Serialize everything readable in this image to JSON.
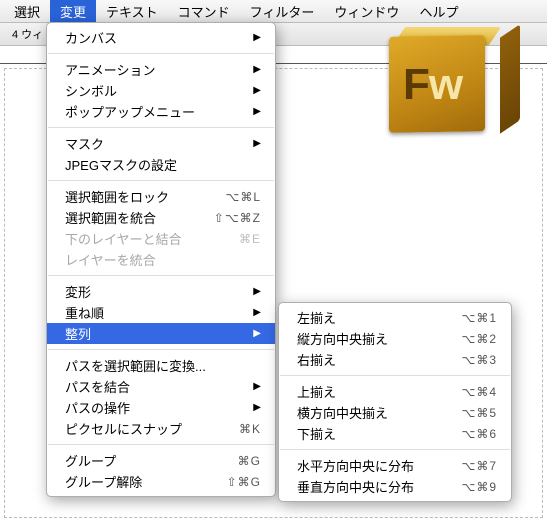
{
  "menubar": {
    "items": [
      "選択",
      "変更",
      "テキスト",
      "コマンド",
      "フィルター",
      "ウィンドウ",
      "ヘルプ"
    ],
    "active_index": 1
  },
  "toolbar": {
    "tab_label": "4 ウィ"
  },
  "logo": {
    "text_f": "F",
    "text_w": "w"
  },
  "menu_main": [
    {
      "type": "item",
      "label": "カンバス",
      "submenu": true
    },
    {
      "type": "sep"
    },
    {
      "type": "item",
      "label": "アニメーション",
      "submenu": true
    },
    {
      "type": "item",
      "label": "シンボル",
      "submenu": true
    },
    {
      "type": "item",
      "label": "ポップアップメニュー",
      "submenu": true
    },
    {
      "type": "sep"
    },
    {
      "type": "item",
      "label": "マスク",
      "submenu": true
    },
    {
      "type": "item",
      "label": "JPEGマスクの設定"
    },
    {
      "type": "sep"
    },
    {
      "type": "item",
      "label": "選択範囲をロック",
      "shortcut": "⌥⌘L"
    },
    {
      "type": "item",
      "label": "選択範囲を統合",
      "shortcut": "⇧⌥⌘Z"
    },
    {
      "type": "item",
      "label": "下のレイヤーと結合",
      "shortcut": "⌘E",
      "disabled": true
    },
    {
      "type": "item",
      "label": "レイヤーを統合",
      "disabled": true
    },
    {
      "type": "sep"
    },
    {
      "type": "item",
      "label": "変形",
      "submenu": true
    },
    {
      "type": "item",
      "label": "重ね順",
      "submenu": true
    },
    {
      "type": "item",
      "label": "整列",
      "submenu": true,
      "highlight": true
    },
    {
      "type": "sep"
    },
    {
      "type": "item",
      "label": "パスを選択範囲に変換..."
    },
    {
      "type": "item",
      "label": "パスを結合",
      "submenu": true
    },
    {
      "type": "item",
      "label": "パスの操作",
      "submenu": true
    },
    {
      "type": "item",
      "label": "ピクセルにスナップ",
      "shortcut": "⌘K"
    },
    {
      "type": "sep"
    },
    {
      "type": "item",
      "label": "グループ",
      "shortcut": "⌘G"
    },
    {
      "type": "item",
      "label": "グループ解除",
      "shortcut": "⇧⌘G"
    }
  ],
  "menu_sub": [
    {
      "type": "item",
      "label": "左揃え",
      "shortcut": "⌥⌘1"
    },
    {
      "type": "item",
      "label": "縦方向中央揃え",
      "shortcut": "⌥⌘2"
    },
    {
      "type": "item",
      "label": "右揃え",
      "shortcut": "⌥⌘3"
    },
    {
      "type": "sep"
    },
    {
      "type": "item",
      "label": "上揃え",
      "shortcut": "⌥⌘4"
    },
    {
      "type": "item",
      "label": "横方向中央揃え",
      "shortcut": "⌥⌘5"
    },
    {
      "type": "item",
      "label": "下揃え",
      "shortcut": "⌥⌘6"
    },
    {
      "type": "sep"
    },
    {
      "type": "item",
      "label": "水平方向中央に分布",
      "shortcut": "⌥⌘7"
    },
    {
      "type": "item",
      "label": "垂直方向中央に分布",
      "shortcut": "⌥⌘9"
    }
  ]
}
